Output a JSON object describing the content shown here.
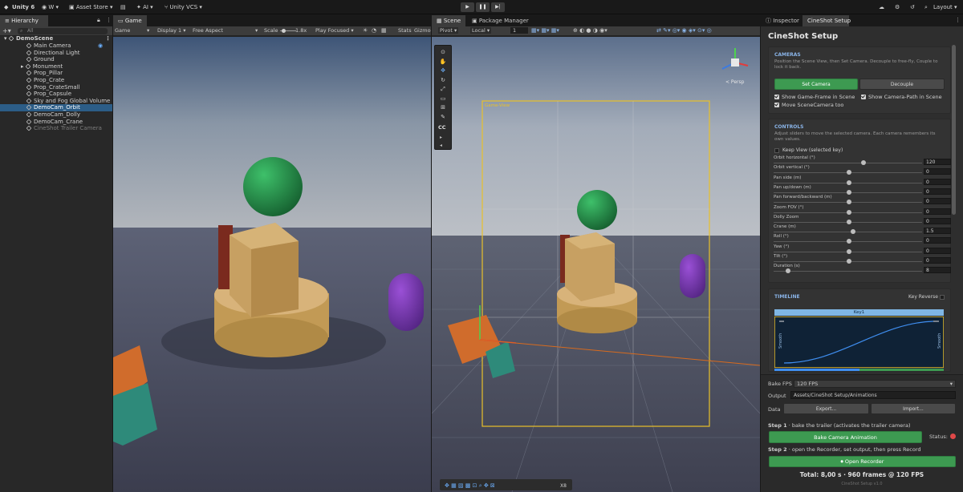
{
  "topbar": {
    "brand": "Unity 6",
    "account": "W",
    "asset_store": "Asset Store",
    "ai": "AI",
    "vcs": "Unity VCS",
    "layout": "Layout"
  },
  "hierarchy": {
    "tab": "Hierarchy",
    "search_placeholder": "All",
    "scene": "DemoScene",
    "items": [
      {
        "label": "Main Camera",
        "selected": false,
        "dim": false
      },
      {
        "label": "Directional Light",
        "selected": false,
        "dim": false
      },
      {
        "label": "Ground",
        "selected": false,
        "dim": false
      },
      {
        "label": "Monument",
        "selected": false,
        "dim": false
      },
      {
        "label": "Prop_Pillar",
        "selected": false,
        "dim": false
      },
      {
        "label": "Prop_Crate",
        "selected": false,
        "dim": false
      },
      {
        "label": "Prop_CrateSmall",
        "selected": false,
        "dim": false
      },
      {
        "label": "Prop_Capsule",
        "selected": false,
        "dim": false
      },
      {
        "label": "Sky and Fog Global Volume",
        "selected": false,
        "dim": false
      },
      {
        "label": "DemoCam_Orbit",
        "selected": true,
        "dim": false
      },
      {
        "label": "DemoCam_Dolly",
        "selected": false,
        "dim": false
      },
      {
        "label": "DemoCam_Crane",
        "selected": false,
        "dim": false
      },
      {
        "label": "CineShot Trailer Camera",
        "selected": false,
        "dim": true
      }
    ]
  },
  "game": {
    "tab": "Game",
    "mode": "Game",
    "display": "Display 1",
    "aspect": "Free Aspect",
    "scale_label": "Scale",
    "scale_value": "1.8x",
    "play_mode": "Play Focused",
    "stats": "Stats",
    "gizmos": "Gizmo"
  },
  "scene_view": {
    "tab": "Scene",
    "tab2": "Package Manager",
    "pivot": "Pivot",
    "space": "Local",
    "grid_value": "1",
    "persp": "< Persp",
    "frame_label": "Game-View",
    "cc": "CC",
    "bottom_zoom": "X8"
  },
  "inspector": {
    "tab1": "Inspector",
    "tab2": "CineShot Setup",
    "title": "CineShot Setup",
    "cameras": {
      "heading": "CAMERAS",
      "desc": "Position the Scene View, then Set Camera. Decouple to free-fly, Couple to lock it back.",
      "set_camera": "Set Camera",
      "decouple": "Decouple",
      "check1": "Show Game-Frame in Scene",
      "check2": "Show Camera-Path in Scene",
      "check3": "Move SceneCamera too"
    },
    "controls": {
      "heading": "CONTROLS",
      "desc": "Adjust sliders to move the selected camera. Each camera remembers its own values.",
      "keep_view": "Keep View (selected key)",
      "sliders": [
        {
          "label": "Orbit horizontal (°)",
          "value": "120",
          "pos": 0.6
        },
        {
          "label": "Orbit vertical (°)",
          "value": "0",
          "pos": 0.5
        },
        {
          "label": "Pan side (m)",
          "value": "0",
          "pos": 0.5
        },
        {
          "label": "Pan up/down (m)",
          "value": "0",
          "pos": 0.5
        },
        {
          "label": "Pan forward/backward (m)",
          "value": "0",
          "pos": 0.5
        },
        {
          "label": "Zoom FOV (°)",
          "value": "0",
          "pos": 0.5
        },
        {
          "label": "Dolly Zoom",
          "value": "0",
          "pos": 0.5
        },
        {
          "label": "Crane (m)",
          "value": "1.5",
          "pos": 0.53
        },
        {
          "label": "Roll (°)",
          "value": "0",
          "pos": 0.5
        },
        {
          "label": "Yaw (°)",
          "value": "0",
          "pos": 0.5
        },
        {
          "label": "Tilt (°)",
          "value": "0",
          "pos": 0.5
        },
        {
          "label": "Duration (s)",
          "value": "8",
          "pos": 0.08
        }
      ]
    },
    "timeline": {
      "heading": "TIMELINE",
      "key_reverse": "Key Reverse",
      "key_label": "Key1",
      "smooth_left": "Smooth",
      "smooth_right": "Smooth"
    },
    "bake_fps_label": "Bake FPS",
    "bake_fps_value": "120 FPS",
    "output_label": "Output",
    "output_value": "Assets/CineShot Setup/Animations",
    "data_label": "Data",
    "export": "Export...",
    "import": "Import...",
    "step1_label": "Step 1",
    "step1_text": "bake the trailer (activates the trailer camera)",
    "bake_button": "Bake Camera Animation",
    "status_label": "Status:",
    "step2_label": "Step 2",
    "step2_text": "open the Recorder, set output, then press Record",
    "recorder_button": "Open Recorder",
    "total": "Total: 8,00 s",
    "frames": "960 frames @ 120 FPS",
    "version": "CineShot Setup v1.0"
  },
  "colors": {
    "accent": "#2c5d87",
    "green": "#3d9a51",
    "status": "#e04848",
    "frame": "#e8c02a"
  }
}
